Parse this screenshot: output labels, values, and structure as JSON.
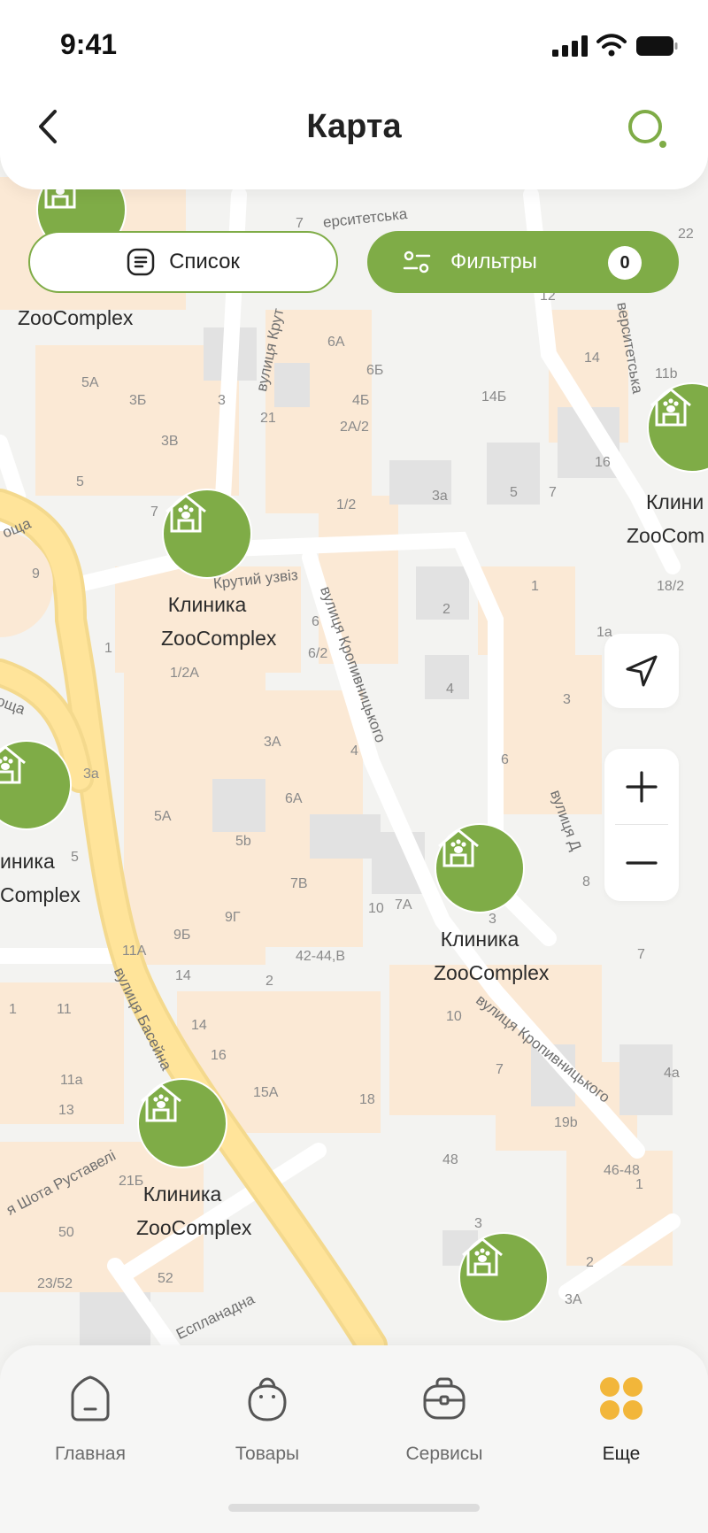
{
  "status_bar": {
    "time": "9:41"
  },
  "header": {
    "title": "Карта"
  },
  "buttons": {
    "list_label": "Список",
    "filter_label": "Фильтры",
    "filter_count": "0"
  },
  "pins": [
    {
      "line1": "Клиника",
      "line2": "ZooComplex"
    },
    {
      "line1": "Клиника",
      "line2": "ZooComplex"
    },
    {
      "line1": "Клиника",
      "line2": "ZooComplex"
    },
    {
      "line1": "Клиника",
      "line2": "ZooComplex"
    },
    {
      "line1": "Клиника",
      "line2": "ZooComplex"
    },
    {
      "line1": "Клиника",
      "line2": "ZooComplex"
    },
    {
      "line1": "",
      "line2": ""
    }
  ],
  "partial_labels": {
    "top_left": "ZooComplex",
    "right_line1": "Клини",
    "right_line2": "ZooCom",
    "left_line1": "иника",
    "left_line2": "Complex"
  },
  "streets": {
    "kruta": "вулиця Крут",
    "universytetska_top": "ерситетська",
    "universytetska_right": "верситетська",
    "krutyi_uzviz": "Крутий узвіз",
    "kropyvnytskoho_1": "вулиця Кропивницького",
    "kropyvnytskoho_2": "вулиця Кропивницького",
    "basseina": "вулиця Басейна",
    "rustaveli": "я Шота Руставелі",
    "esplanadna": "Еспланадна",
    "ploshcha_1": "оща",
    "ploshcha_2": "оща",
    "vulytsia_d": "вулиця Д"
  },
  "house_numbers": [
    "7",
    "22",
    "12",
    "6A",
    "6Б",
    "4Б",
    "14Б",
    "14",
    "11b",
    "5A",
    "3Б",
    "3",
    "2A/2",
    "21",
    "3В",
    "16",
    "5",
    "7",
    "3a",
    "5",
    "1/2",
    "7",
    "9",
    "1",
    "2",
    "18/2",
    "6",
    "1a",
    "1",
    "6/2",
    "4",
    "3",
    "1/2A",
    "3A",
    "4",
    "6",
    "3a",
    "5A",
    "6A",
    "5b",
    "8",
    "7B",
    "10",
    "3",
    "5",
    "7A",
    "9Г",
    "42-44,B",
    "7",
    "9Б",
    "14",
    "11A",
    "2",
    "1",
    "11",
    "14",
    "10",
    "11a",
    "16",
    "7",
    "4a",
    "13",
    "15A",
    "18",
    "19b",
    "48",
    "46-48",
    "1",
    "21Б",
    "3",
    "50",
    "2",
    "52",
    "3A",
    "23/52"
  ],
  "nav": [
    {
      "label": "Главная",
      "icon": "home-icon"
    },
    {
      "label": "Товары",
      "icon": "bag-icon"
    },
    {
      "label": "Сервисы",
      "icon": "briefcase-icon"
    },
    {
      "label": "Еще",
      "icon": "grid-icon"
    }
  ],
  "colors": {
    "accent": "#7fac47",
    "nav_active": "#f2b63a",
    "road_main": "#ffe49a"
  }
}
